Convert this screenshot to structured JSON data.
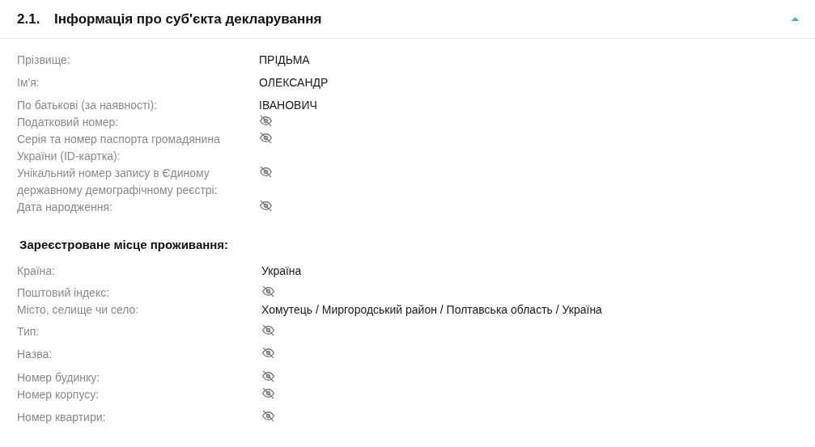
{
  "section": {
    "number": "2.1.",
    "title": "Інформація про суб'єкта декларування",
    "expanded": true
  },
  "person_fields": [
    {
      "label": "Прізвище:",
      "kind": "text",
      "value": "ПРІДЬМА"
    },
    {
      "label": "Ім'я:",
      "kind": "text",
      "value": "ОЛЕКСАНДР"
    },
    {
      "label": "По батькові (за наявності):",
      "kind": "text",
      "value": "ІВАНОВИЧ"
    },
    {
      "label": "Податковий номер:",
      "kind": "hidden"
    },
    {
      "label": "Серія та номер паспорта громадянина України (ID-картка):",
      "kind": "hidden"
    },
    {
      "label": "Унікальний номер запису в Єдиному державному демографічному реєстрі:",
      "kind": "hidden"
    },
    {
      "label": "Дата народження:",
      "kind": "hidden"
    }
  ],
  "address": {
    "heading": "Зареєстроване місце проживання:",
    "fields": [
      {
        "label": "Країна:",
        "kind": "text",
        "value": "Україна"
      },
      {
        "label": "Поштовий індекс:",
        "kind": "hidden"
      },
      {
        "label": "Місто, селище чи село:",
        "kind": "text",
        "value": "Хомутець / Миргородський район / Полтавська область / Україна"
      },
      {
        "label": "Тип:",
        "kind": "hidden"
      },
      {
        "label": "Назва:",
        "kind": "hidden"
      },
      {
        "label": "Номер будинку:",
        "kind": "hidden"
      },
      {
        "label": "Номер корпусу:",
        "kind": "hidden"
      },
      {
        "label": "Номер квартири:",
        "kind": "hidden"
      }
    ]
  }
}
